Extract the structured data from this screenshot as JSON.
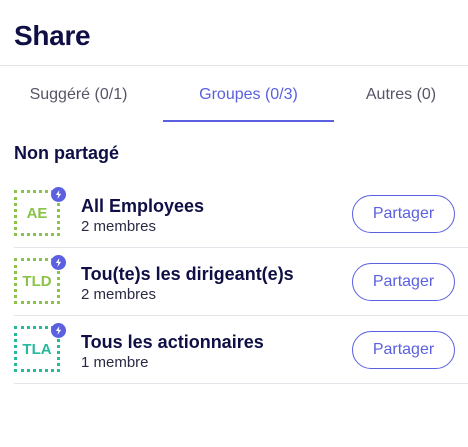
{
  "header": {
    "title": "Share"
  },
  "tabs": [
    {
      "label": "Suggéré (0/1)"
    },
    {
      "label": "Groupes (0/3)"
    },
    {
      "label": "Autres (0)"
    }
  ],
  "active_tab": "Groupes (0/3)",
  "section": {
    "title": "Non partagé"
  },
  "groups": [
    {
      "initials": "AE",
      "name": "All Employees",
      "members": "2 membres",
      "action": "Partager",
      "avatar_color": "#8bc34a"
    },
    {
      "initials": "TLD",
      "name": "Tou(te)s les dirigeant(e)s",
      "members": "2 membres",
      "action": "Partager",
      "avatar_color": "#8bc34a"
    },
    {
      "initials": "TLA",
      "name": "Tous les actionnaires",
      "members": "1 membre",
      "action": "Partager",
      "avatar_color": "#26b99a"
    }
  ],
  "colors": {
    "accent": "#5a60e0",
    "title": "#0f0f45"
  },
  "icons": {
    "badge": "lightning-icon"
  }
}
